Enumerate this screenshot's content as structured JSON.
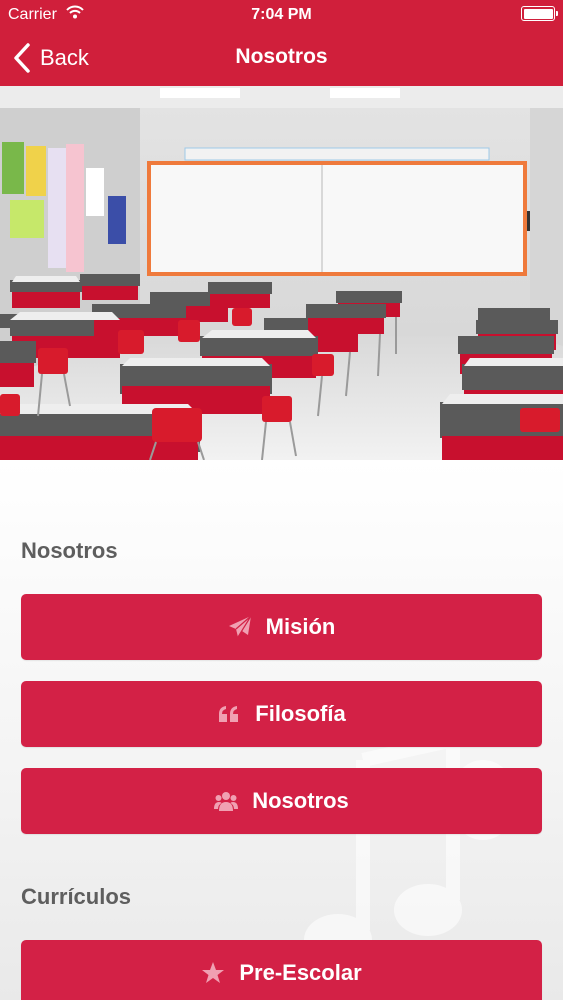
{
  "status_bar": {
    "carrier": "Carrier",
    "time": "7:04 PM"
  },
  "nav": {
    "back_label": "Back",
    "title": "Nosotros"
  },
  "sections": [
    {
      "title": "Nosotros",
      "buttons": [
        {
          "label": "Misión",
          "icon": "paper-plane-icon"
        },
        {
          "label": "Filosofía",
          "icon": "quote-icon"
        },
        {
          "label": "Nosotros",
          "icon": "users-icon"
        }
      ]
    },
    {
      "title": "Currículos",
      "buttons": [
        {
          "label": "Pre-Escolar",
          "icon": "star-icon"
        }
      ]
    }
  ],
  "colors": {
    "nav_bar": "#d01f3b",
    "button": "#d32146",
    "section_title": "#5e5e5e",
    "icon_tint": "#f0a0b2"
  }
}
